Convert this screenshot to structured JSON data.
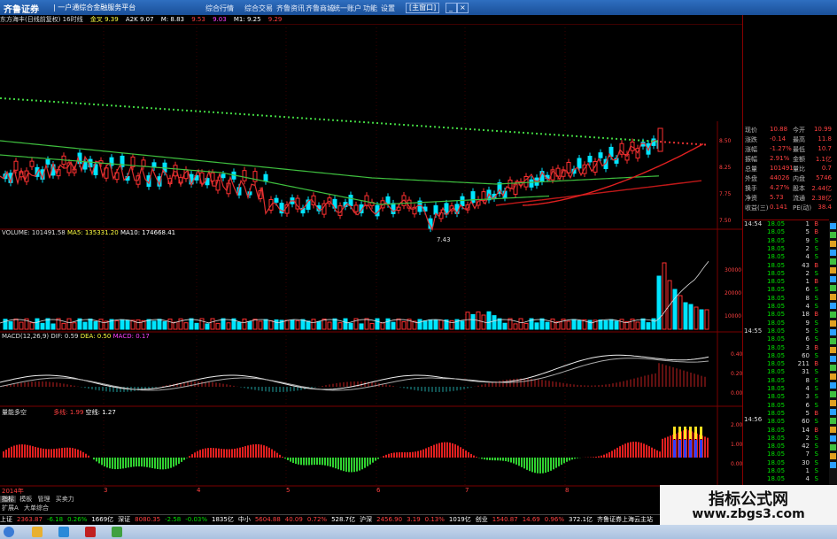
{
  "topbar": {
    "brand": "齐鲁证券",
    "slogan": "| 一户通综合金融服务平台",
    "menu": [
      "综合行情",
      "综合交易",
      "齐鲁资讯",
      "齐鲁商城",
      "统一账户",
      "功能",
      "设置"
    ],
    "win_button": "[主窗口]"
  },
  "infobar": {
    "items": [
      "东方海丰(日线前复权) 16时线",
      "金叉 9.39",
      "A2K 9.07",
      "M: 8.83",
      "9.53",
      "9.03",
      "M1: 9.25",
      "9.29"
    ]
  },
  "volume_label": {
    "items": [
      "VOLUME: 101491.58",
      "MA5: 135331.20",
      "MA10: 174668.41"
    ]
  },
  "macd_label": {
    "items": [
      "MACD(12,26,9) DIF: 0.59",
      "DEA: 0.50",
      "MACD: 0.17"
    ]
  },
  "custom_label": {
    "title": "量能多空",
    "items": [
      "多线: 1.99",
      "空线: 1.27"
    ]
  },
  "price_axis": [
    "8.50",
    "8.25",
    "7.75",
    "7.50"
  ],
  "volume_axis": [
    "30000",
    "20000",
    "10000"
  ],
  "macd_axis": [
    "0.40",
    "0.20",
    "0.00"
  ],
  "custom_axis": [
    "2.00",
    "1.00",
    "0.00"
  ],
  "date_axis": {
    "first": "2014年",
    "marks": [
      "3",
      "4",
      "5",
      "6",
      "7",
      "8"
    ]
  },
  "low_label": "7.43",
  "right_info": {
    "rows": [
      {
        "k": "现价",
        "v": "10.88",
        "k2": "今开",
        "v2": "10.99"
      },
      {
        "k": "涨跌",
        "v": "-0.14",
        "k2": "最高",
        "v2": "11.8"
      },
      {
        "k": "涨幅",
        "v": "-1.27%",
        "k2": "最低",
        "v2": "10.7"
      },
      {
        "k": "振幅",
        "v": "2.91%",
        "k2": "金额",
        "v2": "1.1亿"
      },
      {
        "k": "总量",
        "v": "101491",
        "k2": "量比",
        "v2": "0.7"
      },
      {
        "k": "外盘",
        "v": "44026",
        "k2": "内盘",
        "v2": "5746"
      },
      {
        "k": "换手",
        "v": "4.27%",
        "k2": "股本",
        "v2": "2.44亿"
      },
      {
        "k": "净资",
        "v": "5.73",
        "k2": "流通",
        "v2": "2.38亿"
      },
      {
        "k": "收益(三)",
        "v": "0.141",
        "k2": "PE(动)",
        "v2": "38.4"
      }
    ]
  },
  "time_labels": [
    "14:54",
    "14:55",
    "14:56"
  ],
  "ticks": [
    [
      "18.05",
      "1",
      "B"
    ],
    [
      "18.05",
      "5",
      "B"
    ],
    [
      "18.05",
      "9",
      "S"
    ],
    [
      "18.05",
      "2",
      "S"
    ],
    [
      "18.05",
      "4",
      "S"
    ],
    [
      "18.05",
      "43",
      "B"
    ],
    [
      "18.05",
      "2",
      "S"
    ],
    [
      "18.05",
      "1",
      "B"
    ],
    [
      "18.05",
      "6",
      "S"
    ],
    [
      "18.05",
      "8",
      "S"
    ],
    [
      "18.05",
      "4",
      "S"
    ],
    [
      "18.05",
      "18",
      "B"
    ],
    [
      "18.05",
      "9",
      "S"
    ],
    [
      "18.05",
      "5",
      "S"
    ],
    [
      "18.05",
      "6",
      "S"
    ],
    [
      "18.05",
      "3",
      "B"
    ],
    [
      "18.05",
      "60",
      "S"
    ],
    [
      "18.05",
      "211",
      "B"
    ],
    [
      "18.05",
      "31",
      "S"
    ],
    [
      "18.05",
      "8",
      "S"
    ],
    [
      "18.05",
      "4",
      "S"
    ],
    [
      "18.05",
      "3",
      "S"
    ],
    [
      "18.05",
      "6",
      "S"
    ],
    [
      "18.05",
      "5",
      "B"
    ],
    [
      "18.05",
      "60",
      "S"
    ],
    [
      "18.05",
      "14",
      "B"
    ],
    [
      "18.05",
      "2",
      "S"
    ],
    [
      "18.05",
      "42",
      "S"
    ],
    [
      "18.05",
      "7",
      "S"
    ],
    [
      "18.05",
      "30",
      "S"
    ],
    [
      "18.05",
      "1",
      "S"
    ],
    [
      "18.05",
      "4",
      "S"
    ]
  ],
  "period_tabs": [
    "指标",
    "模板",
    "管理",
    "买卖力"
  ],
  "sub_tabs": [
    "扩展A",
    "大单综合"
  ],
  "statusbar": {
    "items": [
      {
        "t": "上证",
        "c": "#fff"
      },
      {
        "t": "2363.87",
        "c": "#ff4040"
      },
      {
        "t": "-6.18",
        "c": "#00e000"
      },
      {
        "t": "0.26%",
        "c": "#00e000"
      },
      {
        "t": "1669亿",
        "c": "#fff"
      },
      {
        "t": "深证",
        "c": "#fff"
      },
      {
        "t": "8080.35",
        "c": "#ff4040"
      },
      {
        "t": "-2.58",
        "c": "#00e000"
      },
      {
        "t": "-0.03%",
        "c": "#00e000"
      },
      {
        "t": "1835亿",
        "c": "#fff"
      },
      {
        "t": "中小",
        "c": "#fff"
      },
      {
        "t": "5604.88",
        "c": "#ff4040"
      },
      {
        "t": "40.09",
        "c": "#ff4040"
      },
      {
        "t": "0.72%",
        "c": "#ff4040"
      },
      {
        "t": "528.7亿",
        "c": "#fff"
      },
      {
        "t": "沪深",
        "c": "#fff"
      },
      {
        "t": "2456.90",
        "c": "#ff4040"
      },
      {
        "t": "3.19",
        "c": "#ff4040"
      },
      {
        "t": "0.13%",
        "c": "#ff4040"
      },
      {
        "t": "1019亿",
        "c": "#fff"
      },
      {
        "t": "创业",
        "c": "#fff"
      },
      {
        "t": "1540.87",
        "c": "#ff4040"
      },
      {
        "t": "14.69",
        "c": "#ff4040"
      },
      {
        "t": "0.96%",
        "c": "#ff4040"
      },
      {
        "t": "372.1亿",
        "c": "#fff"
      },
      {
        "t": "齐鲁证券上海云主站",
        "c": "#fff"
      }
    ]
  },
  "watermark": {
    "line1": "指标公式网",
    "line2": "www.zbgs3.com"
  },
  "colors": {
    "up": "#ff3030",
    "down": "#00e5ff",
    "ma_green": "#3fbf3f",
    "ma_red": "#d02020",
    "dots": "#40d040",
    "grid": "#7a0000"
  }
}
